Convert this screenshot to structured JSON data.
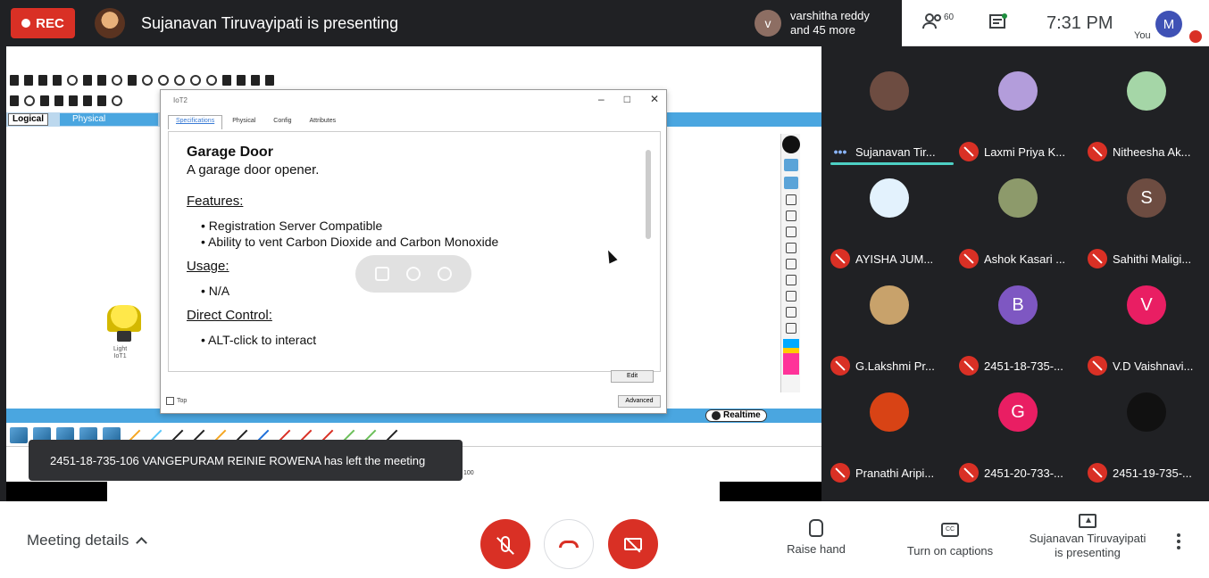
{
  "topbar": {
    "rec_label": "REC",
    "presenting": "Sujanavan Tiruvayipati is presenting",
    "viewer_initial": "v",
    "viewers_line1": "varshitha reddy",
    "viewers_line2": "and 45 more",
    "people_count": "60",
    "time": "7:31 PM",
    "you_initial": "M",
    "you_label": "You"
  },
  "packet_tracer": {
    "logical_tab": "Logical",
    "physical_tab": "Physical",
    "device_label_1": "Light",
    "device_label_2": "IoT1",
    "realtime": "Realtime",
    "dialog_title": "IoT2",
    "tabs": [
      "Specifications",
      "Physical",
      "Config",
      "Attributes"
    ],
    "heading": "Garage Door",
    "description": "A garage door opener.",
    "features_title": "Features:",
    "features": [
      "Registration Server Compatible",
      "Ability to vent Carbon Dioxide and Carbon Monoxide"
    ],
    "usage_title": "Usage:",
    "usage": [
      "N/A"
    ],
    "direct_control_title": "Direct Control:",
    "direct_control": [
      "ALT-click to interact"
    ],
    "edit_button": "Edit",
    "top_checkbox": "Top",
    "advanced_button": "Advanced",
    "strip_value": "100"
  },
  "toast": "2451-18-735-106 VANGEPURAM REINIE ROWENA has left the meeting",
  "participants": [
    {
      "name": "Sujanavan Tir...",
      "initial": "",
      "color": "#6d4c41",
      "speaking": true
    },
    {
      "name": "Laxmi Priya K...",
      "initial": "",
      "color": "#b39ddb",
      "speaking": false
    },
    {
      "name": "Nitheesha Ak...",
      "initial": "",
      "color": "#a5d6a7",
      "speaking": false
    },
    {
      "name": "AYISHA JUM...",
      "initial": "",
      "color": "#e3f2fd",
      "speaking": false
    },
    {
      "name": "Ashok Kasari ...",
      "initial": "",
      "color": "#8d9a6b",
      "speaking": false
    },
    {
      "name": "Sahithi Maligi...",
      "initial": "S",
      "color": "#6d4c41",
      "speaking": false
    },
    {
      "name": "G.Lakshmi Pr...",
      "initial": "",
      "color": "#c8a26b",
      "speaking": false
    },
    {
      "name": "2451-18-735-...",
      "initial": "B",
      "color": "#7e57c2",
      "speaking": false
    },
    {
      "name": "V.D Vaishnavi...",
      "initial": "V",
      "color": "#e91e63",
      "speaking": false
    },
    {
      "name": "Pranathi Aripi...",
      "initial": "",
      "color": "#d84315",
      "speaking": false
    },
    {
      "name": "2451-20-733-...",
      "initial": "G",
      "color": "#e91e63",
      "speaking": false
    },
    {
      "name": "2451-19-735-...",
      "initial": "",
      "color": "#111111",
      "speaking": false
    }
  ],
  "bottom": {
    "meeting_details": "Meeting details",
    "raise_hand": "Raise hand",
    "captions": "Turn on captions",
    "cc_glyph": "CC",
    "presenting_line1": "Sujanavan Tiruvayipati",
    "presenting_line2": "is presenting"
  }
}
